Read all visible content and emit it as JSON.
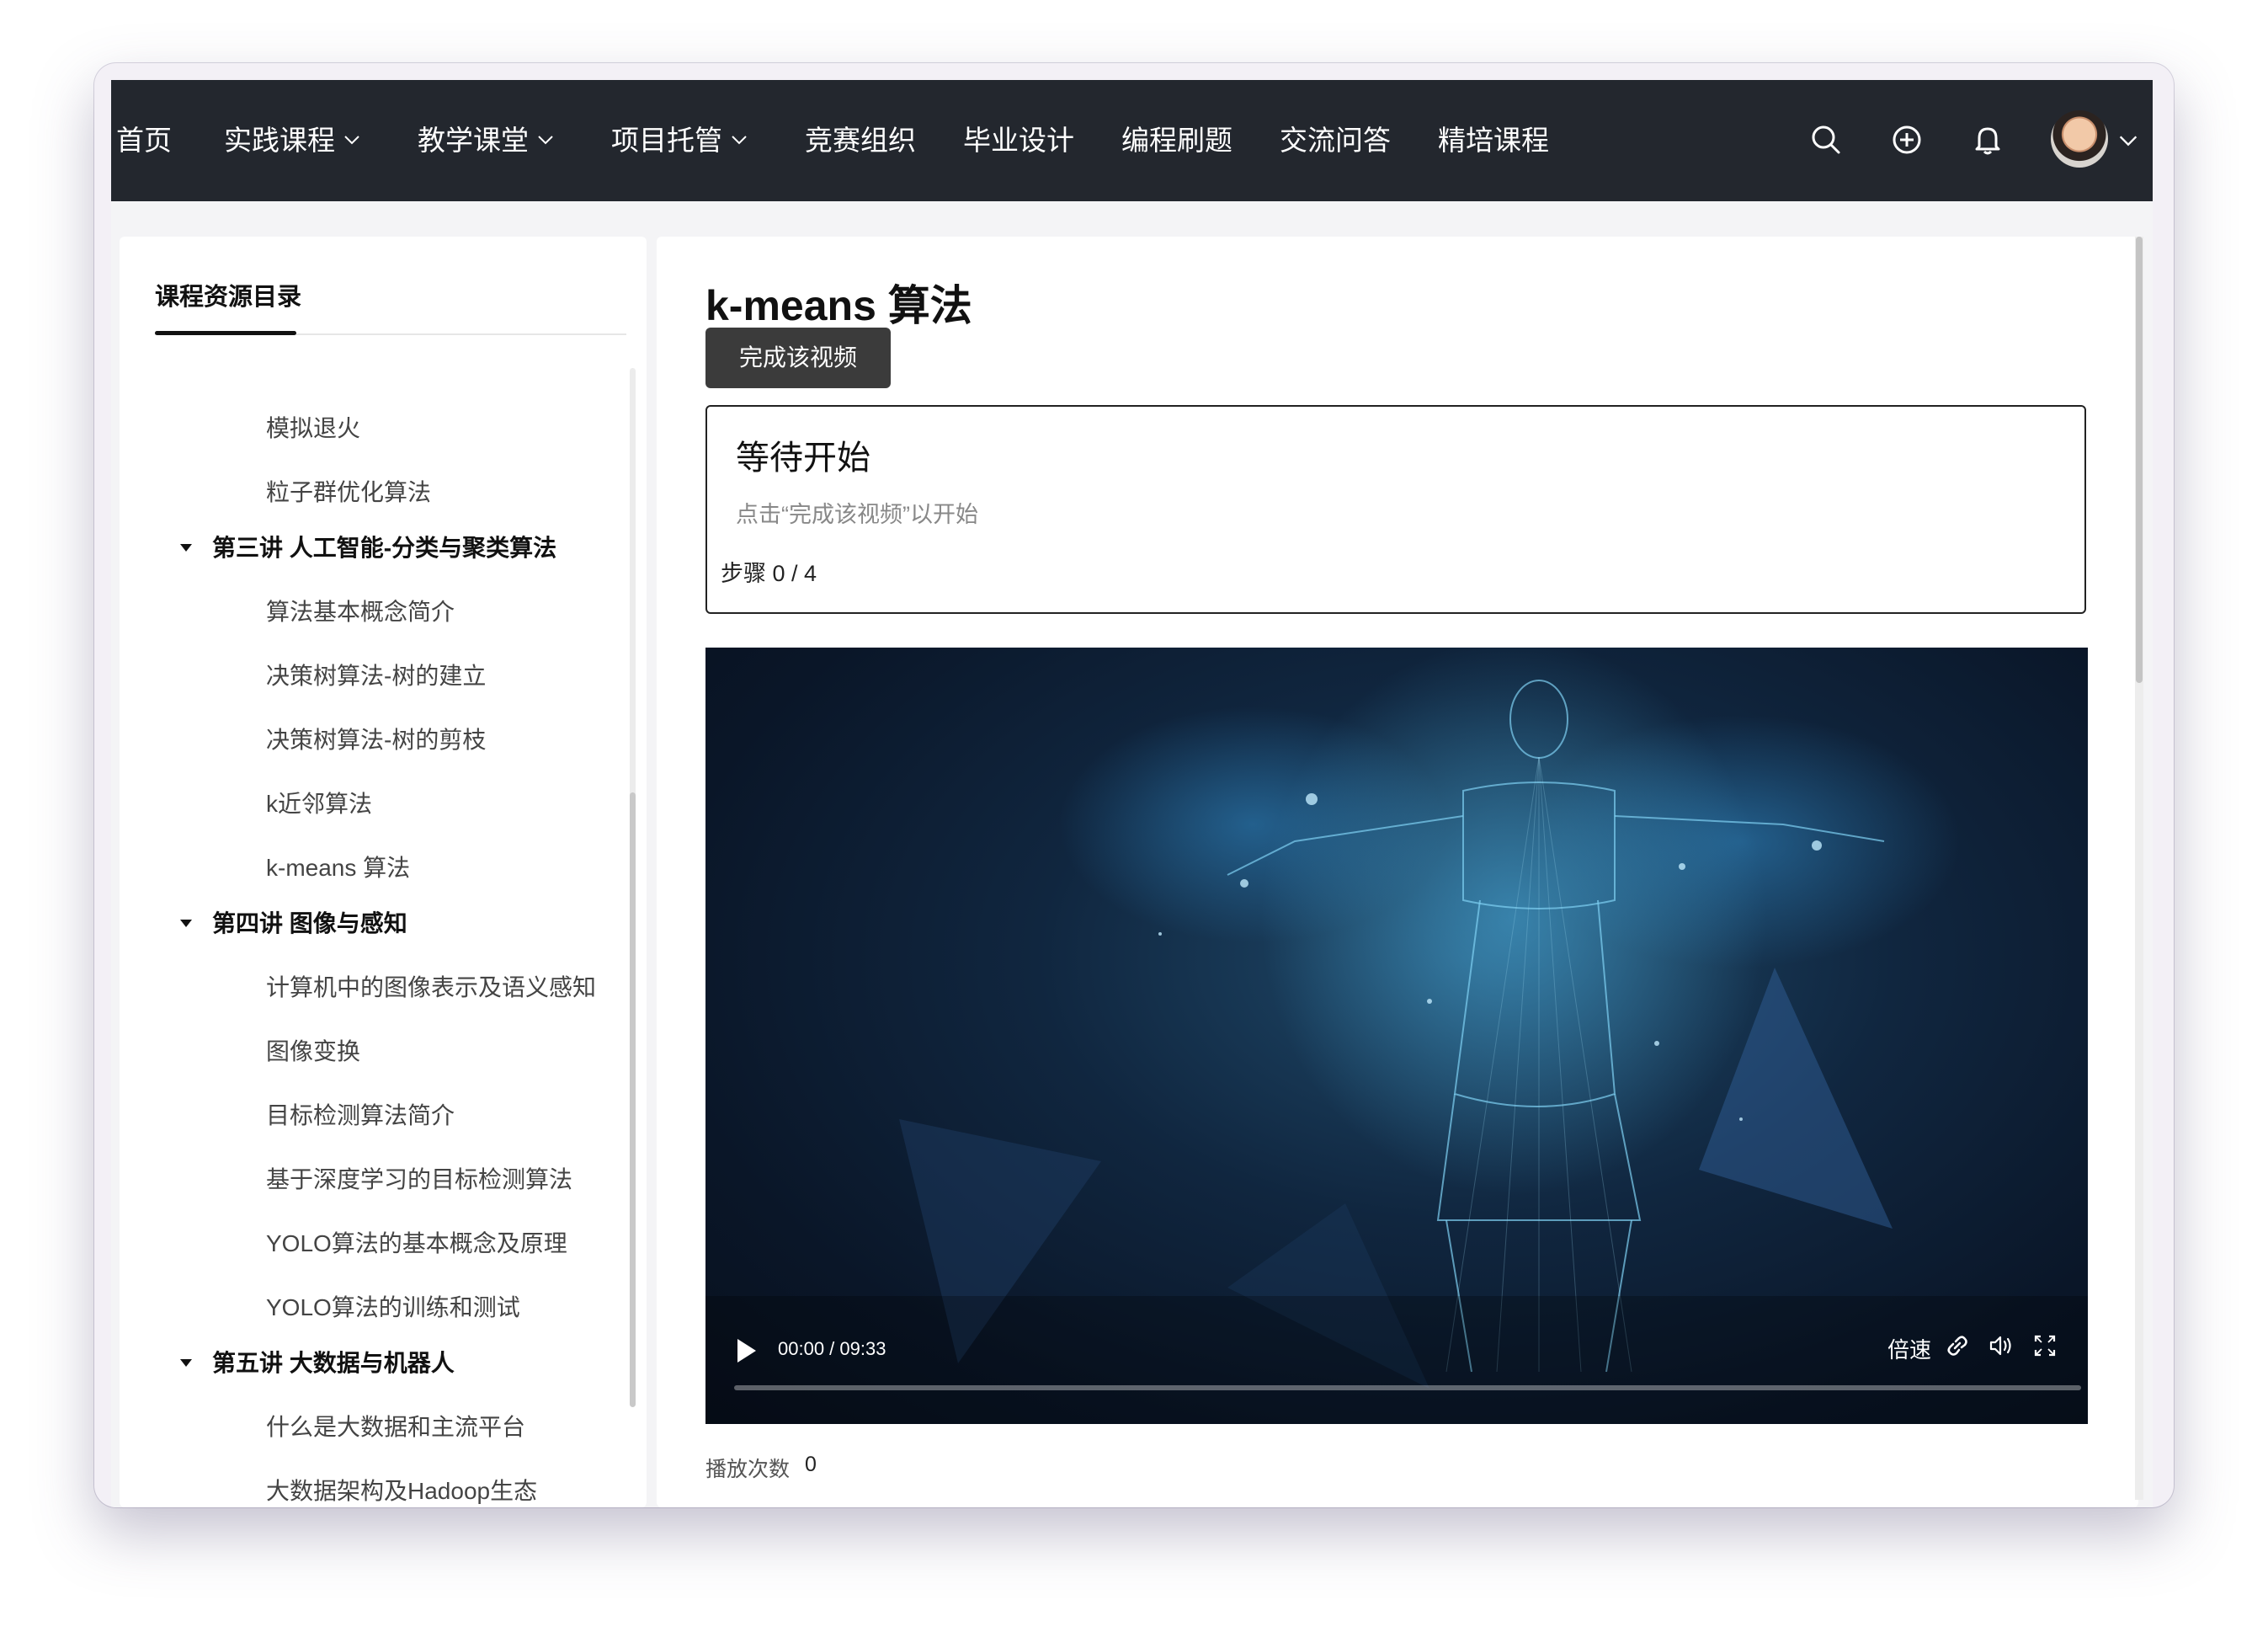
{
  "nav": {
    "items": [
      {
        "label": "首页"
      },
      {
        "label": "实践课程",
        "has_dropdown": true
      },
      {
        "label": "教学课堂",
        "has_dropdown": true
      },
      {
        "label": "项目托管",
        "has_dropdown": true
      },
      {
        "label": "竞赛组织"
      },
      {
        "label": "毕业设计"
      },
      {
        "label": "编程刷题"
      },
      {
        "label": "交流问答"
      },
      {
        "label": "精培课程"
      }
    ],
    "icons": [
      "search-icon",
      "add-circle-icon",
      "bell-icon"
    ],
    "background": "#23272e"
  },
  "sidebar": {
    "title": "课程资源目录",
    "items": [
      {
        "label": "模拟退火",
        "type": "lesson"
      },
      {
        "label": "粒子群优化算法",
        "type": "lesson"
      },
      {
        "label": "第三讲 人工智能-分类与聚类算法",
        "type": "section"
      },
      {
        "label": "算法基本概念简介",
        "type": "lesson"
      },
      {
        "label": "决策树算法-树的建立",
        "type": "lesson"
      },
      {
        "label": "决策树算法-树的剪枝",
        "type": "lesson"
      },
      {
        "label": "k近邻算法",
        "type": "lesson"
      },
      {
        "label": "k-means 算法",
        "type": "lesson"
      },
      {
        "label": "第四讲 图像与感知",
        "type": "section"
      },
      {
        "label": "计算机中的图像表示及语义感知",
        "type": "lesson"
      },
      {
        "label": "图像变换",
        "type": "lesson"
      },
      {
        "label": "目标检测算法简介",
        "type": "lesson"
      },
      {
        "label": "基于深度学习的目标检测算法",
        "type": "lesson"
      },
      {
        "label": "YOLO算法的基本概念及原理",
        "type": "lesson"
      },
      {
        "label": "YOLO算法的训练和测试",
        "type": "lesson"
      },
      {
        "label": "第五讲 大数据与机器人",
        "type": "section"
      },
      {
        "label": "什么是大数据和主流平台",
        "type": "lesson"
      },
      {
        "label": "大数据架构及Hadoop生态",
        "type": "lesson"
      }
    ]
  },
  "main": {
    "title": "k-means 算法",
    "complete_button": "完成该视频",
    "status": {
      "title": "等待开始",
      "hint": "点击“完成该视频”以开始",
      "steps": "步骤 0 / 4"
    },
    "video": {
      "time": "00:00 / 09:33",
      "speed_label": "倍速",
      "progress": 0,
      "control_icons": [
        "play-icon",
        "link-icon",
        "volume-icon",
        "fullscreen-icon"
      ]
    },
    "play_count_label": "播放次数",
    "play_count_value": "0"
  }
}
